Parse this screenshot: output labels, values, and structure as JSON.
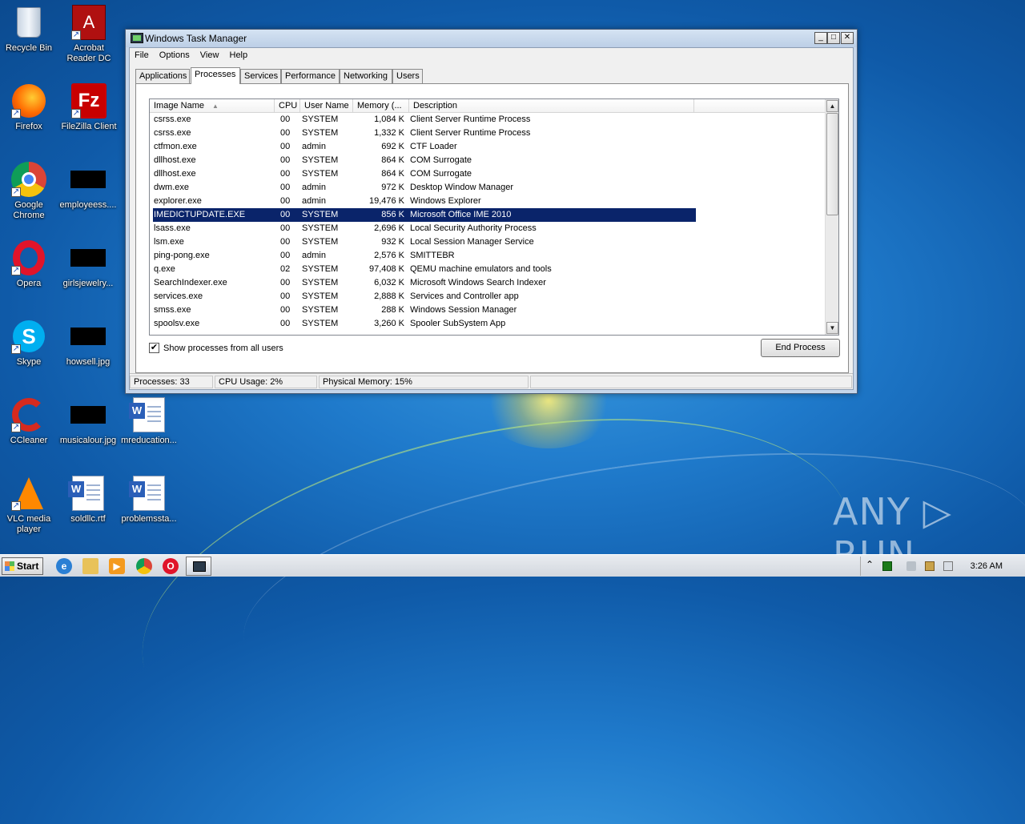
{
  "desktop": {
    "icons": [
      {
        "label": "Recycle Bin",
        "icon": "recycle-bin-icon"
      },
      {
        "label": "Acrobat Reader DC",
        "icon": "acrobat-icon"
      },
      {
        "label": "Firefox",
        "icon": "firefox-icon"
      },
      {
        "label": "FileZilla Client",
        "icon": "filezilla-icon"
      },
      {
        "label": "Google Chrome",
        "icon": "chrome-icon"
      },
      {
        "label": "employeess....",
        "icon": "image-thumbnail-icon"
      },
      {
        "label": "Opera",
        "icon": "opera-icon"
      },
      {
        "label": "girlsjewelry...",
        "icon": "image-thumbnail-icon"
      },
      {
        "label": "Skype",
        "icon": "skype-icon"
      },
      {
        "label": "howsell.jpg",
        "icon": "image-thumbnail-icon"
      },
      {
        "label": "CCleaner",
        "icon": "ccleaner-icon"
      },
      {
        "label": "musicalour.jpg",
        "icon": "image-thumbnail-icon"
      },
      {
        "label": "mreducation...",
        "icon": "word-document-icon"
      },
      {
        "label": "VLC media player",
        "icon": "vlc-icon"
      },
      {
        "label": "soldllc.rtf",
        "icon": "word-document-icon"
      },
      {
        "label": "problemssta...",
        "icon": "word-document-icon"
      }
    ]
  },
  "window": {
    "title": "Windows Task Manager",
    "controls": {
      "minimize": "_",
      "maximize": "□",
      "close": "✕"
    },
    "menu": [
      "File",
      "Options",
      "View",
      "Help"
    ],
    "tabs": [
      "Applications",
      "Processes",
      "Services",
      "Performance",
      "Networking",
      "Users"
    ],
    "active_tab": "Processes",
    "columns": [
      "Image Name",
      "CPU",
      "User Name",
      "Memory (...",
      "Description"
    ],
    "sort_indicator": "▲",
    "rows": [
      {
        "name": "csrss.exe",
        "cpu": "00",
        "user": "SYSTEM",
        "mem": "1,084 K",
        "desc": "Client Server Runtime Process"
      },
      {
        "name": "csrss.exe",
        "cpu": "00",
        "user": "SYSTEM",
        "mem": "1,332 K",
        "desc": "Client Server Runtime Process"
      },
      {
        "name": "ctfmon.exe",
        "cpu": "00",
        "user": "admin",
        "mem": "692 K",
        "desc": "CTF Loader"
      },
      {
        "name": "dllhost.exe",
        "cpu": "00",
        "user": "SYSTEM",
        "mem": "864 K",
        "desc": "COM Surrogate"
      },
      {
        "name": "dllhost.exe",
        "cpu": "00",
        "user": "SYSTEM",
        "mem": "864 K",
        "desc": "COM Surrogate"
      },
      {
        "name": "dwm.exe",
        "cpu": "00",
        "user": "admin",
        "mem": "972 K",
        "desc": "Desktop Window Manager"
      },
      {
        "name": "explorer.exe",
        "cpu": "00",
        "user": "admin",
        "mem": "19,476 K",
        "desc": "Windows Explorer"
      },
      {
        "name": "IMEDICTUPDATE.EXE",
        "cpu": "00",
        "user": "SYSTEM",
        "mem": "856 K",
        "desc": "Microsoft Office IME 2010",
        "selected": true
      },
      {
        "name": "lsass.exe",
        "cpu": "00",
        "user": "SYSTEM",
        "mem": "2,696 K",
        "desc": "Local Security Authority Process"
      },
      {
        "name": "lsm.exe",
        "cpu": "00",
        "user": "SYSTEM",
        "mem": "932 K",
        "desc": "Local Session Manager Service"
      },
      {
        "name": "ping-pong.exe",
        "cpu": "00",
        "user": "admin",
        "mem": "2,576 K",
        "desc": "SMITTEBR"
      },
      {
        "name": "q.exe",
        "cpu": "02",
        "user": "SYSTEM",
        "mem": "97,408 K",
        "desc": "QEMU machine emulators and tools"
      },
      {
        "name": "SearchIndexer.exe",
        "cpu": "00",
        "user": "SYSTEM",
        "mem": "6,032 K",
        "desc": "Microsoft Windows Search Indexer"
      },
      {
        "name": "services.exe",
        "cpu": "00",
        "user": "SYSTEM",
        "mem": "2,888 K",
        "desc": "Services and Controller app"
      },
      {
        "name": "smss.exe",
        "cpu": "00",
        "user": "SYSTEM",
        "mem": "288 K",
        "desc": "Windows Session Manager"
      },
      {
        "name": "spoolsv.exe",
        "cpu": "00",
        "user": "SYSTEM",
        "mem": "3,260 K",
        "desc": "Spooler SubSystem App"
      }
    ],
    "show_all_label": "Show processes from all users",
    "show_all_checked": true,
    "end_process_label": "End Process",
    "status": {
      "processes": "Processes: 33",
      "cpu": "CPU Usage: 2%",
      "memory": "Physical Memory: 15%"
    }
  },
  "taskbar": {
    "start_label": "Start",
    "clock": "3:26 AM",
    "pinned": [
      "internet-explorer-icon",
      "explorer-folder-icon",
      "media-player-icon",
      "chrome-icon",
      "opera-icon"
    ],
    "tray_expand": "⌃"
  },
  "watermark": "ANY ▷ RUN"
}
